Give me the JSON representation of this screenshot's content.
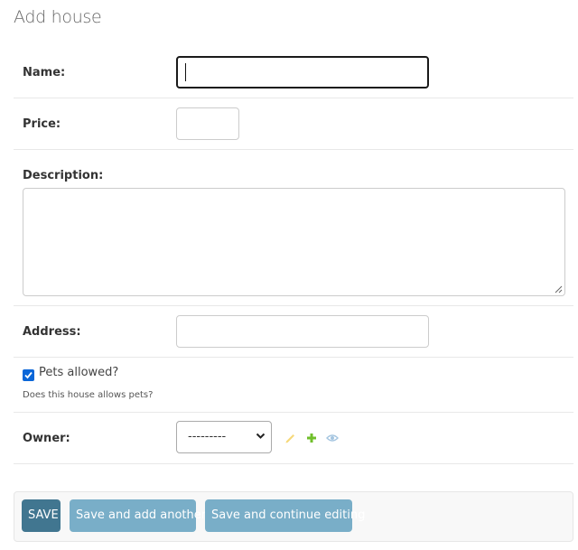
{
  "page": {
    "title": "Add house"
  },
  "form": {
    "name": {
      "label": "Name:",
      "value": ""
    },
    "price": {
      "label": "Price:",
      "value": ""
    },
    "description": {
      "label": "Description:",
      "value": ""
    },
    "address": {
      "label": "Address:",
      "value": ""
    },
    "pets": {
      "label": "Pets allowed?",
      "checked": true,
      "help": "Does this house allows pets?"
    },
    "owner": {
      "label": "Owner:",
      "selected": "---------",
      "actions": [
        "change-icon",
        "add-icon",
        "view-icon"
      ]
    }
  },
  "submit": {
    "save": "SAVE",
    "save_add_another": "Save and add another",
    "save_continue": "Save and continue editing"
  },
  "colors": {
    "primary_button": "#417690",
    "secondary_button": "#79aec8",
    "checkbox": "#0a66d8",
    "change_icon": "#efb80b",
    "add_icon": "#70bf2b",
    "view_icon": "#a4c5e0"
  }
}
